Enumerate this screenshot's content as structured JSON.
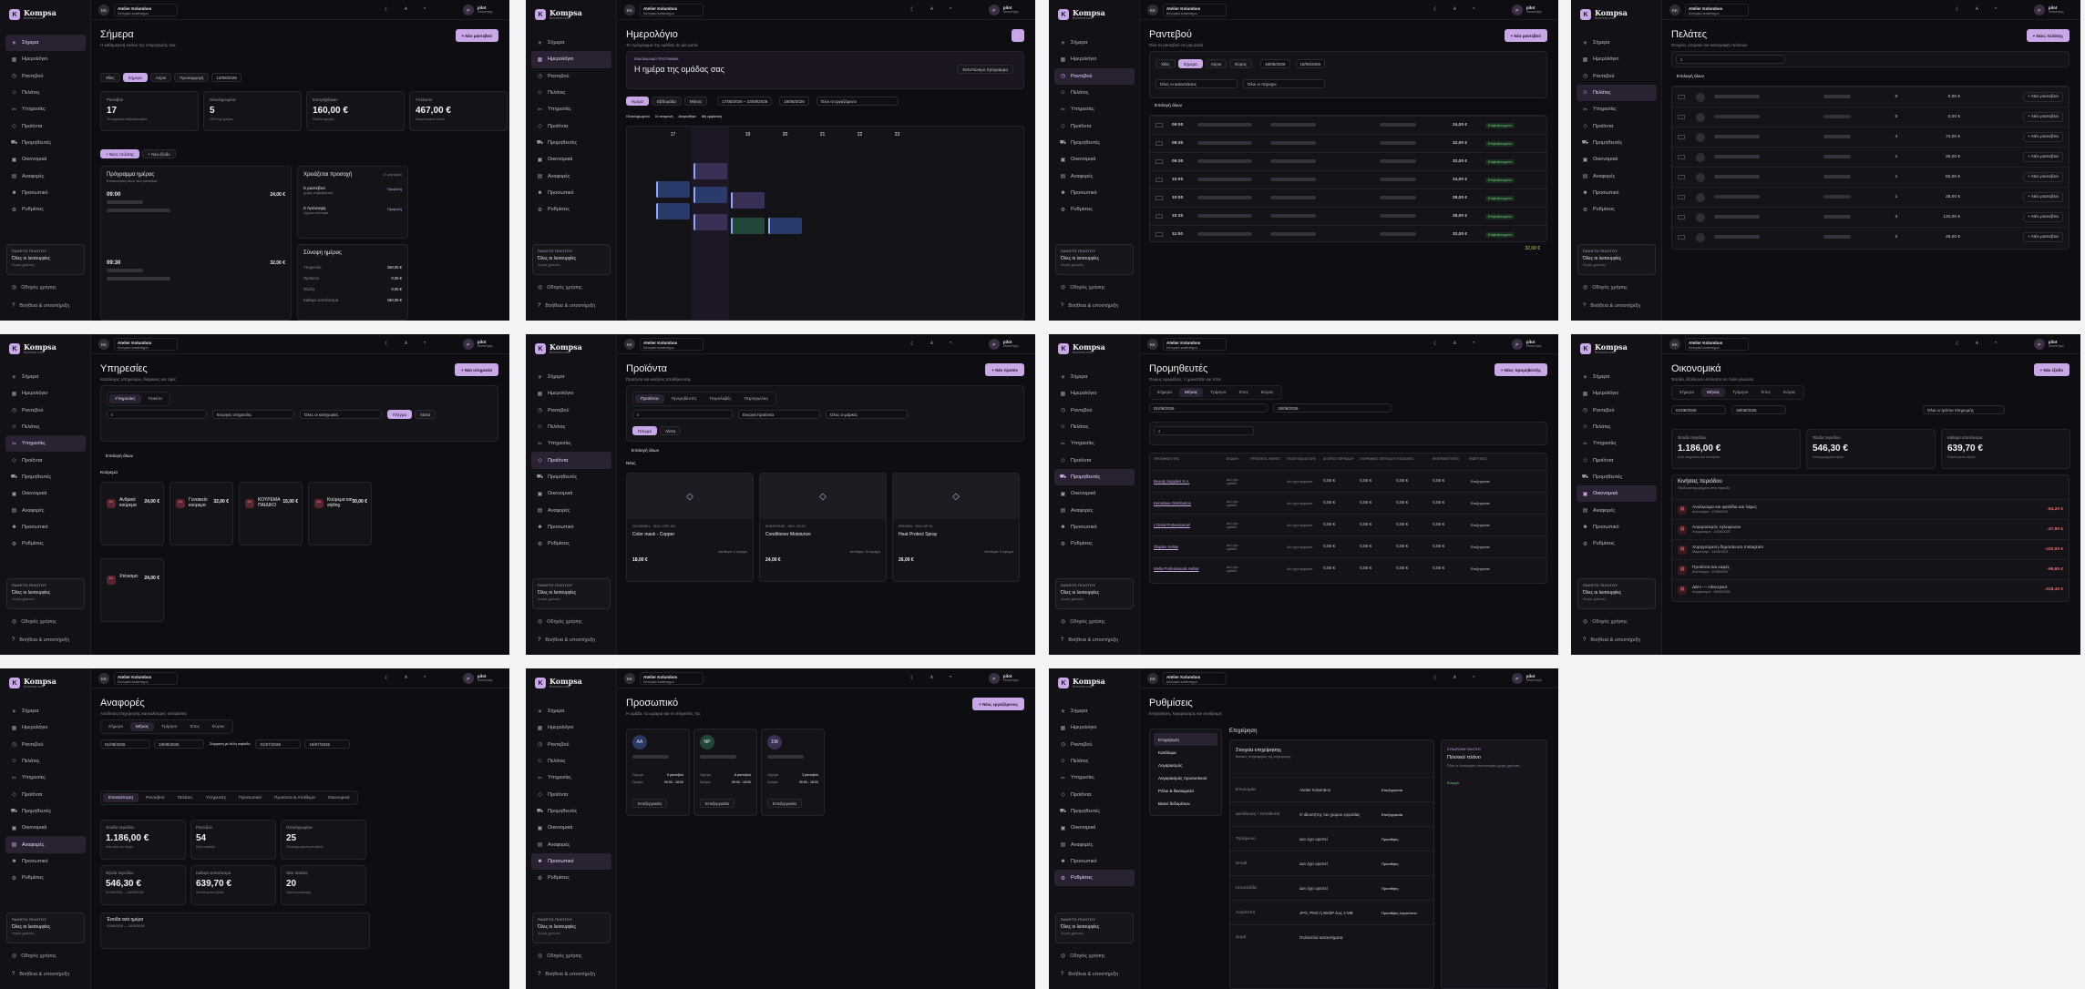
{
  "app": {
    "name": "Kompsa",
    "tagline": "Business suite",
    "initials": "KK",
    "studio_name": "Atelier Kolumbos",
    "branch": "Κεντρικό κατάστημα",
    "user_name": "pilot",
    "user_role": "Ιδιοκτήτης"
  },
  "nav": [
    "Σήμερα",
    "Ημερολόγιο",
    "Ραντεβού",
    "Πελάτες",
    "Υπηρεσίες",
    "Προϊόντα",
    "Προμηθευτές",
    "Οικονομικά",
    "Αναφορές",
    "Προσωπικό",
    "Ρυθμίσεις"
  ],
  "nav_icons": [
    "sun-icon",
    "calendar-icon",
    "clock-icon",
    "users-icon",
    "scissors-icon",
    "box-icon",
    "truck-icon",
    "wallet-icon",
    "chart-icon",
    "staff-icon",
    "gear-icon"
  ],
  "plan": {
    "title": "ΠΑΚΕΤΟ ΠΙΛΟΤΟΥ",
    "value": "Όλες οι λειτουργίες",
    "sub": "Χωρίς χρέωση"
  },
  "footer": {
    "guide": "Οδηγός χρήσης",
    "help": "Βοήθεια & υποστήριξη"
  },
  "today": {
    "title": "Σήμερα",
    "subtitle": "Η καθημερινή εικόνα της επιχείρησής σας",
    "btn": "+ Νέο ραντεβού",
    "chips": [
      "Χθες",
      "Σήμερα",
      "Αύριο",
      "Προσαρμογή"
    ],
    "date": "13/08/2026",
    "kpis": [
      {
        "label": "Ραντεβού",
        "value": "17",
        "sub": "Τα σημερινά επιβεβαιωμένα"
      },
      {
        "label": "Ολοκληρωμένα",
        "value": "5",
        "sub": "29% της ημέρας"
      },
      {
        "label": "Εισπράχθηκαν",
        "value": "160,00 €",
        "sub": "Έσοδα ημέρας"
      },
      {
        "label": "Υπόλοιπο",
        "value": "467,00 €",
        "sub": "Αναμενόμενα έσοδα"
      }
    ],
    "actions": [
      "+ Νέος πελάτης",
      "+ Νέο έξοδο"
    ],
    "schedule_title": "Πρόγραμμα ημέρας",
    "schedule_sub": "Επισκόπηση όλων των ραντεβού",
    "attention": "Χρειάζεται προσοχή",
    "attention_count": "17 ραντεβού",
    "appts": [
      {
        "time": "09:00",
        "price": "24,00 €"
      },
      {
        "time": "09:30",
        "price": "32,00 €"
      }
    ],
    "att_items": [
      {
        "label": "0 ραντεβού",
        "sub": "χωρίς επιβεβαίωση",
        "link": "Προβολή"
      },
      {
        "label": "0 πρόσοψη",
        "sub": "λήγουν σύντομα",
        "link": "Προβολή"
      }
    ],
    "summary_title": "Σύνοψη ημέρας",
    "summary_rows": [
      {
        "k": "Υπηρεσίες",
        "v": "160,00 €"
      },
      {
        "k": "Προϊόντα",
        "v": "0,00 €"
      },
      {
        "k": "Έξοδα",
        "v": "0,00 €"
      },
      {
        "k": "Καθαρό αποτέλεσμα",
        "v": "160,00 €"
      }
    ]
  },
  "calendar": {
    "title": "Ημερολόγιο",
    "subtitle": "Το πρόγραμμα της ομάδας σε μία ματιά",
    "hero_tag": "ΕΒΔΟΜΑΔΙΑΙΟ ΠΡΟΓΡΑΜΜΑ",
    "hero_title": "Η ημέρα της ομάδας σας",
    "hero_btn": "Εκτυπώσιμο πρόγραμμα",
    "range": "17/08/2026 – 23/08/2026",
    "date": "18/08/2026",
    "views": [
      "Ημέρα",
      "Εβδομάδα",
      "Μήνας"
    ],
    "staff_label": "Όλοι οι εργαζόμενοι",
    "days": [
      "17",
      "18",
      "19",
      "20",
      "21",
      "22",
      "23"
    ],
    "legend": [
      "Ολοκληρωμένο",
      "Σε αναμονή",
      "Ακυρώθηκε",
      "Μη εμφάνιση"
    ]
  },
  "appointments": {
    "title": "Ραντεβού",
    "subtitle": "Όλα τα ραντεβού σε μια ματιά",
    "btn": "+ Νέο ραντεβού",
    "chips": [
      "Χθες",
      "Σήμερα",
      "Αύριο",
      "Εύρος"
    ],
    "from": "18/08/2026",
    "to": "18/08/2026",
    "filters": [
      "Όλες οι καταστάσεις",
      "Όλοι οι πάροχοι"
    ],
    "select_all": "Επιλογή όλων",
    "rows": [
      {
        "time": "09:00",
        "price": "24,00 €",
        "status": "Επιβεβαιωμένο"
      },
      {
        "time": "09:30",
        "price": "32,00 €",
        "status": "Επιβεβαιωμένο"
      },
      {
        "time": "09:30",
        "price": "32,00 €",
        "status": "Επιβεβαιωμένο"
      },
      {
        "time": "10:00",
        "price": "24,00 €",
        "status": "Επιβεβαιωμένο"
      },
      {
        "time": "10:00",
        "price": "28,00 €",
        "status": "Επιβεβαιωμένο"
      },
      {
        "time": "10:30",
        "price": "28,00 €",
        "status": "Επιβεβαιωμένο"
      },
      {
        "time": "11:00",
        "price": "32,00 €",
        "status": "Επιβεβαιωμένο"
      }
    ],
    "total": "32,00 €"
  },
  "clients": {
    "title": "Πελάτες",
    "subtitle": "Στοιχεία, ιστορικό και καταγραφή πελατών",
    "btn": "+ Νέος πελάτης",
    "select_all": "Επιλογή όλων",
    "row_btn": "+ Νέο ραντεβού",
    "rows": [
      {
        "visits": "0",
        "spent": "0,00 €"
      },
      {
        "visits": "0",
        "spent": "0,00 €"
      },
      {
        "visits": "4",
        "spent": "74,00 €"
      },
      {
        "visits": "1",
        "spent": "28,00 €"
      },
      {
        "visits": "1",
        "spent": "82,00 €"
      },
      {
        "visits": "1",
        "spent": "28,00 €"
      },
      {
        "visits": "3",
        "spent": "134,00 €"
      },
      {
        "visits": "2",
        "spent": "48,00 €"
      }
    ]
  },
  "services": {
    "title": "Υπηρεσίες",
    "subtitle": "Κατάλογος υπηρεσιών, διάρκειες και τιμές",
    "btn": "+ Νέα υπηρεσία",
    "tabs": [
      "Υπηρεσίες",
      "Πακέτα"
    ],
    "view": [
      "Πλέγμα",
      "Λίστα"
    ],
    "filters": [
      "Ενεργές υπηρεσίες",
      "Όλες οι κατηγορίες"
    ],
    "select_all": "Επιλογή όλων",
    "group": "Κούρεμα",
    "group2": "Υπηρεσία",
    "cards": [
      {
        "name": "Ανδρικό κούρεμα",
        "price": "24,00 €"
      },
      {
        "name": "Γυναικείο κούρεμα",
        "price": "32,00 €"
      },
      {
        "name": "ΚΟΥΡΕΜΑ ΠΑΙΔΙΚΟ",
        "price": "15,00 €"
      },
      {
        "name": "Κούρεμα και styling",
        "price": "30,00 €"
      },
      {
        "name": "Χτένισμα",
        "price": "24,00 €"
      }
    ]
  },
  "products": {
    "title": "Προϊόντα",
    "subtitle": "Προϊόντα και κινήσεις αποθήκευσης",
    "btn": "+ Νέο προϊόν",
    "tabs": [
      "Προϊόντα",
      "Προμηθευτές",
      "Παραλαβές",
      "Παραγγελίες"
    ],
    "view": [
      "Πλέγμα",
      "Λίστα"
    ],
    "filters": [
      "Ενεργά προϊόντα",
      "Όλες οι μάρκες"
    ],
    "select_all": "Επιλογή όλων",
    "group": "Νέος",
    "cards": [
      {
        "tag": "GOLDWELL · SKU: CPR-100",
        "name": "Color mask - Copper",
        "price": "18,00 €",
        "stock": "Απόθεμα: 0 τεμάχια"
      },
      {
        "tag": "KERASTASE · SKU: CR-01",
        "name": "Conditioner Moisturize",
        "price": "24,00 €",
        "stock": "Απόθεμα: 11 τεμάχια"
      },
      {
        "tag": "REDKEN · SKU: HP-01",
        "name": "Heat Protect Spray",
        "price": "26,00 €",
        "stock": "Απόθεμα: 0 τεμάχια"
      }
    ]
  },
  "suppliers": {
    "title": "Προμηθευτές",
    "subtitle": "Ποιους αγοράζετε, τι χρωστάτε και πότε",
    "btn": "+ Νέος προμηθευτής",
    "periods": [
      "Σήμερα",
      "Μήνας",
      "Τρίμηνο",
      "Έτος",
      "Εύρος"
    ],
    "from": "01/08/2026",
    "to": "18/08/2026",
    "cols": [
      "ΠΡΟΜΗΘΕΥΤΗΣ",
      "ΕΠΑΦΗ",
      "ΠΡΟΪΟΝΤΑ",
      "ΠΑΡΑΓΓ.",
      "ΤΕΛΕΥΤΑΙΑ ΑΓΟΡΑ",
      "ΑΓΟΡΕΣ ΠΕΡΙΟΔΟΥ",
      "ΠΛΗΡΩΜΕΣ ΠΕΡΙΟΔΟΥ",
      "ΥΠΟΛΟΙΠΟ",
      "ΕΚΚΡΕΜΟΤΗΤΕΣ",
      "ΕΝΕΡΓΕΙΕΣ"
    ],
    "rows": [
      {
        "name": "Beauty Supplies S.A.",
        "contact": "Δεν έχει οριστεί",
        "last": "Δεν έχει αγοράσει",
        "v1": "0,00 €",
        "v2": "0,00 €",
        "v3": "0,00 €",
        "v4": "0,00 €"
      },
      {
        "name": "Kerastase Distribution",
        "contact": "Δεν έχει οριστεί",
        "last": "Δεν έχει αγοράσει",
        "v1": "0,00 €",
        "v2": "0,00 €",
        "v3": "0,00 €",
        "v4": "0,00 €"
      },
      {
        "name": "L'Oréal Professionnel",
        "contact": "Δεν έχει οριστεί",
        "last": "Δεν έχει αγοράσει",
        "v1": "0,00 €",
        "v2": "0,00 €",
        "v3": "0,00 €",
        "v4": "0,00 €"
      },
      {
        "name": "Olaplex Hellas",
        "contact": "Δεν έχει οριστεί",
        "last": "Δεν έχει αγοράσει",
        "v1": "0,00 €",
        "v2": "0,00 €",
        "v3": "0,00 €",
        "v4": "0,00 €"
      },
      {
        "name": "Wella Professionals Hellas",
        "contact": "Δεν έχει οριστεί",
        "last": "Δεν έχει αγοράσει",
        "v1": "0,00 €",
        "v2": "0,00 €",
        "v3": "0,00 €",
        "v4": "0,00 €"
      }
    ],
    "action": "Επεξεργασία"
  },
  "finance": {
    "title": "Οικονομικά",
    "subtitle": "Έσοδα, έξοδα και υπόλοιπο σε πολύ γλώσσα",
    "btn": "+ Νέο έξοδο",
    "periods": [
      "Σήμερα",
      "Μήνας",
      "Τρίμηνο",
      "Έτος",
      "Εύρος"
    ],
    "from": "01/08/2026",
    "to": "18/08/2026",
    "method": "Όλοι οι τρόποι πληρωμής",
    "kpis": [
      {
        "label": "Έσοδα περιόδου",
        "value": "1.186,00 €",
        "sub": "Από υπηρεσίες και πωλήσεις"
      },
      {
        "label": "Έξοδα περιόδου",
        "value": "546,30 €",
        "sub": "Καταχωρημένα έξοδα"
      },
      {
        "label": "Καθαρό αποτέλεσμα",
        "value": "639,70 €",
        "sub": "Έσοδα μείον έξοδα"
      }
    ],
    "exp_title": "Κινήσεις περιόδου",
    "exp_sub": "Έξοδα καταχωρημένα στην περίοδο",
    "expenses": [
      {
        "name": "Αναλώσιμα και φιαλίδια και λάμες",
        "sub": "Αναλώσιμα · 17/08/2026",
        "amount": "-63,20 €"
      },
      {
        "name": "Λογαριασμός τηλεφώνου",
        "sub": "Λογαριασμοί · 14/08/2026",
        "amount": "-47,90 €"
      },
      {
        "name": "Χορηγούμενη δημοσίευση Instagram",
        "sub": "Μάρκετινγκ · 12/08/2026",
        "amount": "-120,00 €"
      },
      {
        "name": "Προϊόντα και καφές",
        "sub": "Αναλώσιμα · 11/08/2026",
        "amount": "-96,80 €"
      },
      {
        "name": "ΔΕΗ — Ηλεκτρικό",
        "sub": "Λογαριασμοί · 05/08/2026",
        "amount": "-218,40 €"
      }
    ]
  },
  "reports": {
    "title": "Αναφορές",
    "subtitle": "Απόδοση επιχείρησης και καλύτερες αποφάσεις",
    "periods": [
      "Σήμερα",
      "Μήνας",
      "Τρίμηνο",
      "Έτος",
      "Εύρος"
    ],
    "from": "01/08/2026",
    "to": "18/08/2026",
    "compare": "Σύγκριση με άλλη περίοδο",
    "cfrom": "01/07/2026",
    "cto": "18/07/2026",
    "tabs": [
      "Επισκόπηση",
      "Ραντεβού",
      "Πελάτες",
      "Υπηρεσίες",
      "Προσωπικό",
      "Προϊόντα & Απόθεμα",
      "Οικονομικά"
    ],
    "kpis": [
      {
        "label": "Έσοδα περιόδου",
        "value": "1.186,00 €",
        "sub": "Από όλες τις πηγές"
      },
      {
        "label": "Ραντεβού",
        "value": "54",
        "sub": "Στην περίοδο"
      },
      {
        "label": "Ολοκληρωμένα",
        "value": "25",
        "sub": "Ολοκληρωμένα ραντεβού"
      },
      {
        "label": "Έξοδα περιόδου",
        "value": "546,30 €",
        "sub": "01/08/2026 — 18/08/2026"
      },
      {
        "label": "Καθαρό αποτέλεσμα",
        "value": "639,70 €",
        "sub": "Έσοδα μείον έξοδα"
      },
      {
        "label": "Νέοι πελάτες",
        "value": "20",
        "sub": "Πρώτη επίσκεψη"
      }
    ],
    "daily": "Έσοδα ανά ημέρα",
    "daily_sub": "01/08/2026 — 18/08/2026"
  },
  "staff": {
    "title": "Προσωπικό",
    "subtitle": "Η ομάδα, τα ωράρια και οι υπηρεσίες της",
    "btn": "+ Νέος εργαζόμενος",
    "people": [
      {
        "init": "AA",
        "color": "#2b3a63",
        "appts": "5 ραντεβού",
        "hours": "09:00 - 18:00"
      },
      {
        "init": "NP",
        "color": "#22473a",
        "appts": "6 ραντεβού",
        "hours": "09:00 - 18:00"
      },
      {
        "init": "ΣΜ",
        "color": "#3b2f54",
        "appts": "3 ραντεβού",
        "hours": "09:00 - 18:00"
      }
    ],
    "lbl_today": "Σήμερα",
    "lbl_hours": "Ωράριο",
    "edit": "Επεξεργασία"
  },
  "settings": {
    "title": "Ρυθμίσεις",
    "subtitle": "Επιχείρηση, λογαριασμός και συνδρομή",
    "menu": [
      "Επιχείρηση",
      "Κατάλυμα",
      "Λογαριασμός",
      "Λογαριασμός προσωπικού",
      "Ρόλοι & δικαιώματα",
      "Βασεί δεδομένων"
    ],
    "section": "Επιχείρηση",
    "block_title": "Στοιχεία επιχείρησης",
    "block_sub": "Βασικές πληροφορίες της επιχείρησης",
    "fields": [
      {
        "k": "Επωνυμία",
        "v": "Atelier Kolumbos",
        "a": "Επεξεργασία"
      },
      {
        "k": "Διεύθυνση / τοποθεσία",
        "v": "Ο ιδιοκτήτης του χώρου εργασίας",
        "a": "Επεξεργασία"
      },
      {
        "k": "Τηλέφωνο",
        "v": "Δεν έχει οριστεί",
        "a": "Προσθήκη"
      },
      {
        "k": "Email",
        "v": "Δεν έχει οριστεί",
        "a": "Προσθήκη"
      },
      {
        "k": "Ιστοσελίδα",
        "v": "Δεν έχει οριστεί",
        "a": "Προσθήκη"
      },
      {
        "k": "Λογότυπο",
        "v": "JPG, PNG ή WebP έως 2 MB",
        "a": "Προσθήκη λογοτύπου"
      },
      {
        "k": "Δομή",
        "v": "Πολλαπλά καταστήματα",
        "a": ""
      }
    ],
    "plan_tag": "ΣΥΝΔΡΟΜΗ ΠΙΛΟΤΟΥ",
    "plan_title": "Πιλοτικό πλάνο",
    "plan_text": "Όλες οι λειτουργίες είναι ενεργές χωρίς χρέωση",
    "plan_status": "Ενεργό"
  },
  "colors": {
    "accent": "#c9a8e8",
    "bg": "#0e0e12",
    "sidebar": "#121216",
    "green": "#6fcf7f",
    "red": "#f07171"
  }
}
